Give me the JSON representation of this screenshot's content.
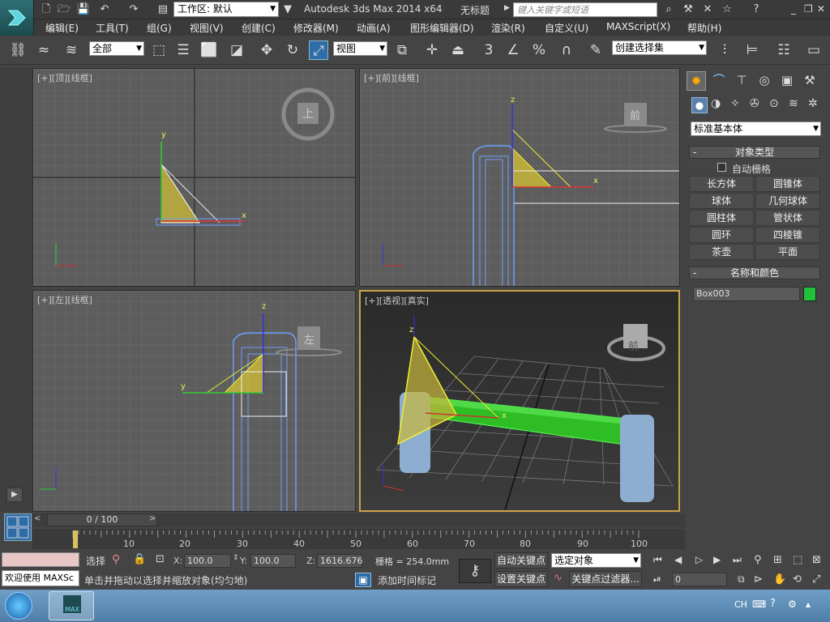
{
  "app": {
    "logo_text": "▼",
    "workspace": "工作区: 默认",
    "title": "Autodesk 3ds Max  2014 x64",
    "doc": "无标题",
    "search_placeholder": "键入关键字或短语"
  },
  "menu": [
    "编辑(E)",
    "工具(T)",
    "组(G)",
    "视图(V)",
    "创建(C)",
    "修改器(M)",
    "动画(A)",
    "图形编辑器(D)",
    "渲染(R)",
    "自定义(U)",
    "MAXScript(X)",
    "帮助(H)"
  ],
  "toolbar": {
    "selection_filter": "全部",
    "ref_coord": "视图",
    "named_selection": "创建选择集",
    "snap_3": "3",
    "snap_pct": "%"
  },
  "viewports": {
    "top": {
      "label": "[+][顶][线框]",
      "cube": "上"
    },
    "front": {
      "label": "[+][前][线框]",
      "cube": "前"
    },
    "left": {
      "label": "[+][左][线框]",
      "cube": "左"
    },
    "persp": {
      "label": "[+][透视][真实]",
      "cube": "前"
    }
  },
  "axes": {
    "x": "x",
    "y": "y",
    "z": "z"
  },
  "cmdpanel": {
    "category": "标准基本体",
    "object_type_header": "对象类型",
    "auto_grid": "自动栅格",
    "buttons": [
      "长方体",
      "圆锥体",
      "球体",
      "几何球体",
      "圆柱体",
      "管状体",
      "圆环",
      "四棱锥",
      "茶壶",
      "平面"
    ],
    "name_color_header": "名称和颜色",
    "object_name": "Box003",
    "object_color": "#21c23a"
  },
  "timeline": {
    "frame": "0 / 100",
    "ticks": [
      "10",
      "20",
      "30",
      "40",
      "50",
      "60",
      "70",
      "80",
      "90",
      "100"
    ]
  },
  "status": {
    "select_label": "选择",
    "x_label": "X:",
    "x_value": "100.0",
    "y_label": "Y:",
    "y_value": "100.0",
    "z_label": "Z:",
    "z_value": "1616.676",
    "grid": "栅格 = 254.0mm",
    "auto_key": "自动关键点",
    "selected_object": "选定对象",
    "set_key": "设置关键点",
    "key_filters": "关键点过滤器...",
    "welcome": "欢迎使用 MAXSc",
    "prompt": "单击并拖动以选择并缩放对象(均匀地)",
    "add_time_tag": "添加时间标记",
    "frame_field": "0"
  },
  "taskbar": {
    "app_label": "MAX",
    "lang": "CH"
  }
}
